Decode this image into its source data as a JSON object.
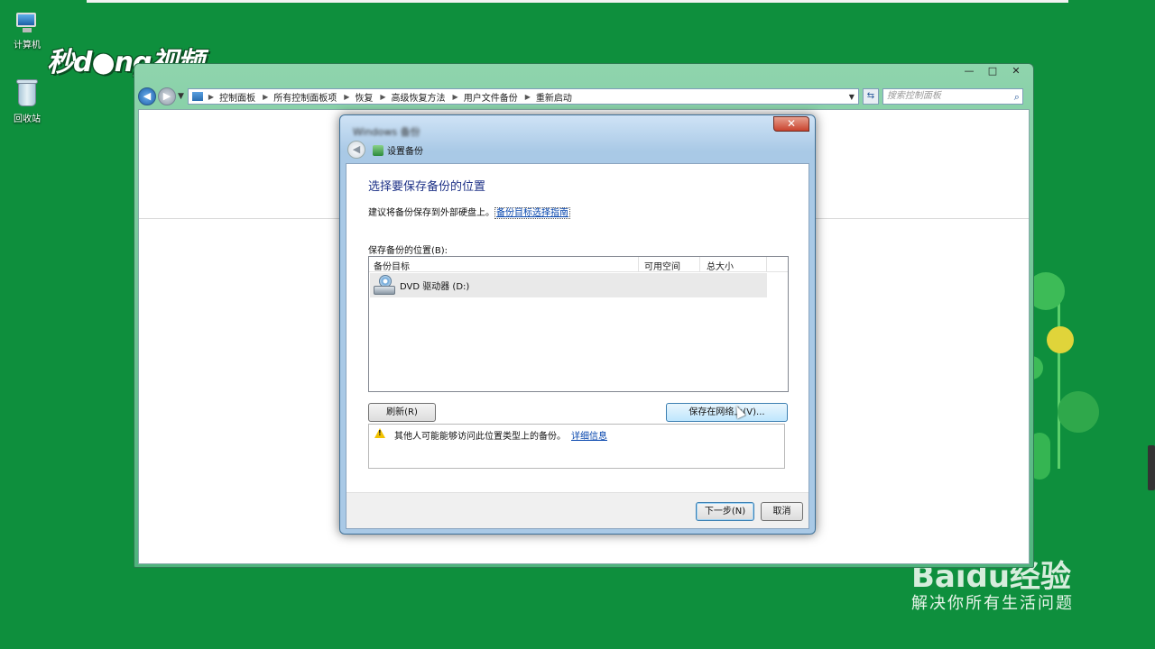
{
  "desktop": {
    "icons": [
      {
        "label": "计算机"
      },
      {
        "label": "回收站"
      }
    ]
  },
  "watermarks": {
    "video_logo": "秒d●ng视频",
    "baidu_logo": "Baidu经验",
    "baidu_slogan": "解决你所有生活问题"
  },
  "explorer": {
    "window_controls": {
      "minimize": "—",
      "maximize": "□",
      "close": "✕"
    },
    "breadcrumbs": [
      "控制面板",
      "所有控制面板项",
      "恢复",
      "高级恢复方法",
      "用户文件备份",
      "重新启动"
    ],
    "search_placeholder": "搜索控制面板"
  },
  "dialog": {
    "title": "Windows 备份",
    "close_glyph": "✕",
    "header_title": "设置备份",
    "header_subtitle": "",
    "heading": "选择要保存备份的位置",
    "suggest_text": "建议将备份保存到外部硬盘上。",
    "suggest_link": "备份目标选择指南",
    "location_label": "保存备份的位置(B):",
    "columns": [
      "备份目标",
      "可用空间",
      "总大小"
    ],
    "rows": [
      {
        "name": "DVD 驱动器 (D:)",
        "free": "",
        "total": ""
      }
    ],
    "refresh_button": "刷新(R)",
    "network_button": "保存在网络上(V)...",
    "warning_text": "其他人可能能够访问此位置类型上的备份。",
    "warning_link": "详细信息",
    "next_button": "下一步(N)",
    "cancel_button": "取消"
  },
  "colors": {
    "desktop_bg": "#0e8f3d",
    "heading_color": "#1e3287",
    "link_color": "#0645ad"
  }
}
